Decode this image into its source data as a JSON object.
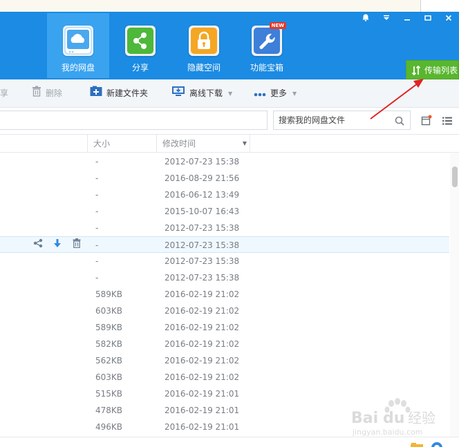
{
  "nav": {
    "items": [
      {
        "label": "我的网盘",
        "icon": "cloud-drive-icon",
        "active": true
      },
      {
        "label": "分享",
        "icon": "share-icon",
        "active": false
      },
      {
        "label": "隐藏空间",
        "icon": "lock-icon",
        "active": false
      },
      {
        "label": "功能宝箱",
        "icon": "toolbox-icon",
        "active": false,
        "badge": "NEW"
      }
    ]
  },
  "transfer": {
    "label": "传输列表"
  },
  "toolbar": {
    "share_label": "享",
    "delete_label": "删除",
    "new_folder_label": "新建文件夹",
    "offline_download_label": "离线下载",
    "more_label": "更多"
  },
  "search": {
    "placeholder": "搜索我的网盘文件"
  },
  "columns": {
    "size": "大小",
    "modified": "修改时间"
  },
  "files": [
    {
      "size": "-",
      "modified": "2012-07-23 15:38"
    },
    {
      "size": "-",
      "modified": "2016-08-29 21:56"
    },
    {
      "size": "-",
      "modified": "2016-06-12 13:49"
    },
    {
      "size": "-",
      "modified": "2015-10-07 16:43"
    },
    {
      "size": "-",
      "modified": "2012-07-23 15:38"
    },
    {
      "size": "-",
      "modified": "2012-07-23 15:38"
    },
    {
      "size": "-",
      "modified": "2012-07-23 15:38"
    },
    {
      "size": "-",
      "modified": "2012-07-23 15:38"
    },
    {
      "size": "589KB",
      "modified": "2016-02-19 21:02"
    },
    {
      "size": "603KB",
      "modified": "2016-02-19 21:02"
    },
    {
      "size": "589KB",
      "modified": "2016-02-19 21:02"
    },
    {
      "size": "582KB",
      "modified": "2016-02-19 21:02"
    },
    {
      "size": "562KB",
      "modified": "2016-02-19 21:02"
    },
    {
      "size": "603KB",
      "modified": "2016-02-19 21:02"
    },
    {
      "size": "515KB",
      "modified": "2016-02-19 21:01"
    },
    {
      "size": "478KB",
      "modified": "2016-02-19 21:01"
    },
    {
      "size": "496KB",
      "modified": "2016-02-19 21:01"
    }
  ],
  "watermark": {
    "text": "Baidu 经验",
    "url_text": "jingyan.baidu.com"
  },
  "colors": {
    "header": "#1b8be3",
    "transfer": "#58b62f",
    "annotation": "#e02424"
  }
}
